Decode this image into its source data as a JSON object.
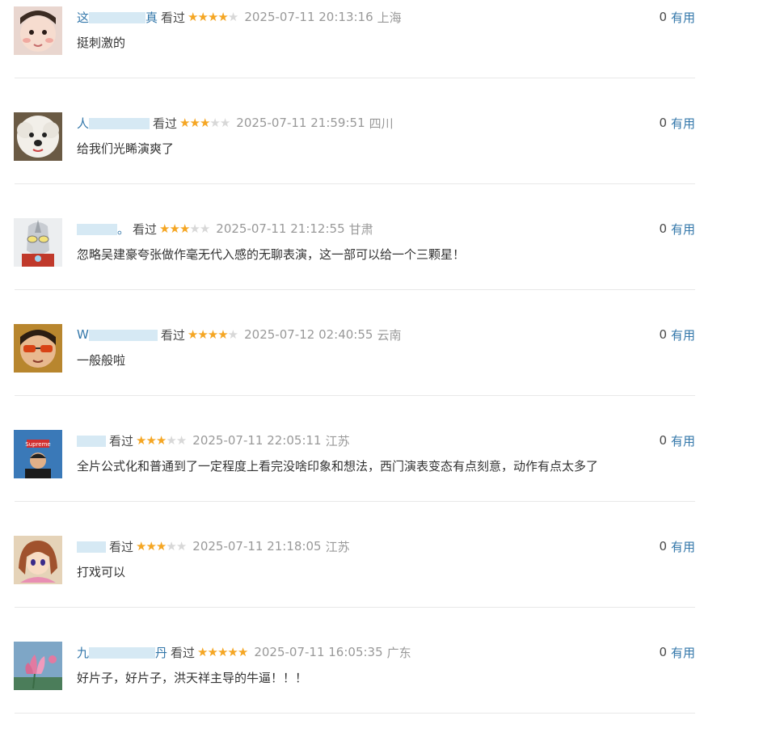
{
  "colors": {
    "link": "#3377aa",
    "star_on": "#f5a623",
    "star_off": "#d8d8d8",
    "meta": "#999999",
    "divider": "#e8e8e8"
  },
  "comments": [
    {
      "name": "这",
      "mask_w": 70,
      "name_tail": "真",
      "watched": "看过",
      "rating": 4,
      "time": "2025-07-11 20:13:16",
      "location": "上海",
      "text": "挺刺激的",
      "votes": "0",
      "useful": "有用",
      "avatar_icon": "baby-avatar-icon"
    },
    {
      "name": "人",
      "mask_w": 75,
      "name_tail": "",
      "watched": "看过",
      "rating": 3,
      "time": "2025-07-11 21:59:51",
      "location": "四川",
      "text": "给我们光睎演爽了",
      "votes": "0",
      "useful": "有用",
      "avatar_icon": "white-dog-avatar-icon"
    },
    {
      "name": "",
      "mask_w": 50,
      "name_tail": "。",
      "watched": "看过",
      "rating": 3,
      "time": "2025-07-11 21:12:55",
      "location": "甘肃",
      "text": "忽略吴建豪夸张做作毫无代入感的无聊表演，这一部可以给一个三颗星！",
      "votes": "0",
      "useful": "有用",
      "avatar_icon": "robot-hero-avatar-icon"
    },
    {
      "name": "W",
      "mask_w": 85,
      "name_tail": "",
      "watched": "看过",
      "rating": 4,
      "time": "2025-07-12 02:40:55",
      "location": "云南",
      "text": "一般般啦",
      "votes": "0",
      "useful": "有用",
      "avatar_icon": "sunglasses-man-avatar-icon"
    },
    {
      "name": "",
      "mask_w": 36,
      "name_tail": "",
      "watched": "看过",
      "rating": 3,
      "time": "2025-07-11 22:05:11",
      "location": "江苏",
      "text": "全片公式化和普通到了一定程度上看完没啥印象和想法，西门演表变态有点刻意，动作有点太多了",
      "votes": "0",
      "useful": "有用",
      "avatar_icon": "supreme-man-avatar-icon"
    },
    {
      "name": "",
      "mask_w": 36,
      "name_tail": "",
      "watched": "看过",
      "rating": 3,
      "time": "2025-07-11 21:18:05",
      "location": "江苏",
      "text": "打戏可以",
      "votes": "0",
      "useful": "有用",
      "avatar_icon": "anime-girl-avatar-icon"
    },
    {
      "name": "九",
      "mask_w": 82,
      "name_tail": "丹",
      "watched": "看过",
      "rating": 5,
      "time": "2025-07-11 16:05:35",
      "location": "广东",
      "text": "好片子，好片子，洪天祥主导的牛逼！！！",
      "votes": "0",
      "useful": "有用",
      "avatar_icon": "lotus-avatar-icon"
    }
  ]
}
